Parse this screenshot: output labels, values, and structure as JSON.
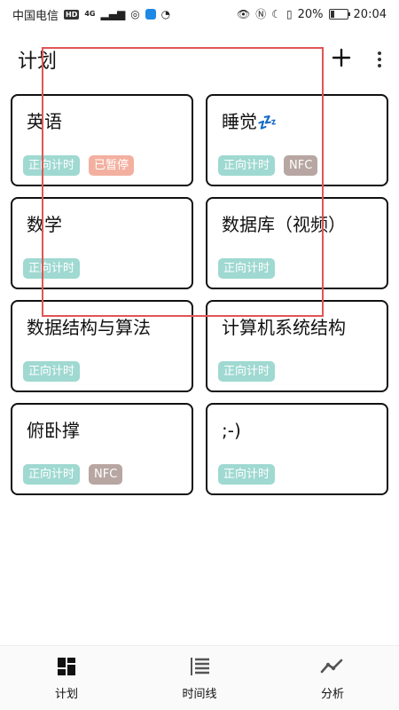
{
  "status_bar": {
    "carrier": "中国电信",
    "hd": "HD",
    "network": "4G",
    "battery": "20%",
    "battery_level": 0.2,
    "time": "20:04"
  },
  "app_bar": {
    "title": "计划"
  },
  "cards": [
    {
      "title": "英语",
      "emoji": "",
      "tags": [
        {
          "label": "正向计时",
          "color": "#9fd9d1"
        },
        {
          "label": "已暂停",
          "color": "#f3b0a0"
        }
      ]
    },
    {
      "title": "睡觉",
      "emoji": "💤",
      "tags": [
        {
          "label": "正向计时",
          "color": "#9fd9d1"
        },
        {
          "label": "NFC",
          "color": "#b7a6a2"
        }
      ]
    },
    {
      "title": "数学",
      "emoji": "",
      "tags": [
        {
          "label": "正向计时",
          "color": "#9fd9d1"
        }
      ]
    },
    {
      "title": "数据库（视频）",
      "emoji": "",
      "tags": [
        {
          "label": "正向计时",
          "color": "#9fd9d1"
        }
      ]
    },
    {
      "title": "数据结构与算法",
      "emoji": "",
      "tags": [
        {
          "label": "正向计时",
          "color": "#9fd9d1"
        }
      ]
    },
    {
      "title": "计算机系统结构",
      "emoji": "",
      "tags": [
        {
          "label": "正向计时",
          "color": "#9fd9d1"
        }
      ]
    },
    {
      "title": "俯卧撑",
      "emoji": "",
      "tags": [
        {
          "label": "正向计时",
          "color": "#9fd9d1"
        },
        {
          "label": "NFC",
          "color": "#b7a6a2"
        }
      ]
    },
    {
      "title": ";-)",
      "emoji": "",
      "tags": [
        {
          "label": "正向计时",
          "color": "#9fd9d1"
        }
      ]
    }
  ],
  "bottom_nav": {
    "items": [
      {
        "label": "计划",
        "icon": "dashboard-icon"
      },
      {
        "label": "时间线",
        "icon": "timeline-icon"
      },
      {
        "label": "分析",
        "icon": "trend-icon"
      }
    ]
  },
  "colors": {
    "highlight": "#e05555",
    "tag_timer": "#9fd9d1",
    "tag_paused": "#f3b0a0",
    "tag_nfc": "#b7a6a2"
  }
}
